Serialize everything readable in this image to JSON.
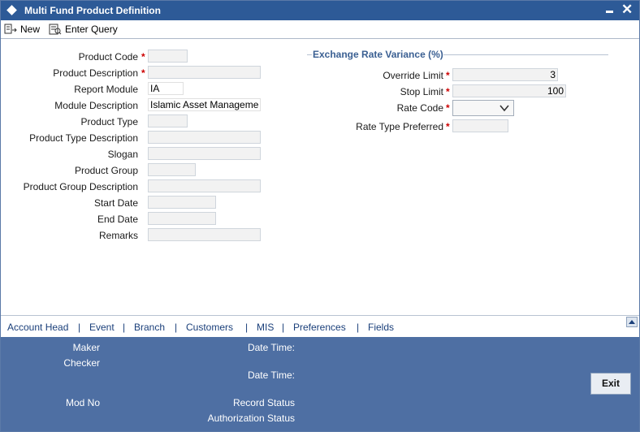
{
  "window": {
    "title": "Multi Fund Product Definition"
  },
  "toolbar": {
    "new_label": "New",
    "enter_query_label": "Enter Query"
  },
  "form": {
    "product_code": {
      "label": "Product Code",
      "value": ""
    },
    "product_description": {
      "label": "Product Description",
      "value": ""
    },
    "report_module": {
      "label": "Report Module",
      "value": "IA"
    },
    "module_description": {
      "label": "Module Description",
      "value": "Islamic Asset Manageme"
    },
    "product_type": {
      "label": "Product Type",
      "value": ""
    },
    "product_type_description": {
      "label": "Product Type Description",
      "value": ""
    },
    "slogan": {
      "label": "Slogan",
      "value": ""
    },
    "product_group": {
      "label": "Product Group",
      "value": ""
    },
    "product_group_description": {
      "label": "Product Group Description",
      "value": ""
    },
    "start_date": {
      "label": "Start Date",
      "value": ""
    },
    "end_date": {
      "label": "End Date",
      "value": ""
    },
    "remarks": {
      "label": "Remarks",
      "value": ""
    },
    "required_marker": "*"
  },
  "exchange": {
    "section_title": "Exchange Rate Variance (%)",
    "override_limit": {
      "label": "Override Limit",
      "value": "3"
    },
    "stop_limit": {
      "label": "Stop Limit",
      "value": "100"
    },
    "rate_code": {
      "label": "Rate Code",
      "value": ""
    },
    "rate_type_preferred": {
      "label": "Rate Type Preferred",
      "value": ""
    }
  },
  "tabs": {
    "items": [
      "Account Head",
      "Event",
      "Branch",
      "Customers",
      "MIS",
      "Preferences",
      "Fields"
    ],
    "separator": "|"
  },
  "footer": {
    "maker": "Maker",
    "checker": "Checker",
    "date_time_1": "Date Time:",
    "date_time_2": "Date Time:",
    "mod_no": "Mod No",
    "record_status": "Record Status",
    "authorization_status": "Authorization Status",
    "exit_label": "Exit"
  },
  "colors": {
    "titlebar": "#2d5a97",
    "footer": "#4e6fa3",
    "required": "#cc0000",
    "section_title": "#3a5f92"
  }
}
